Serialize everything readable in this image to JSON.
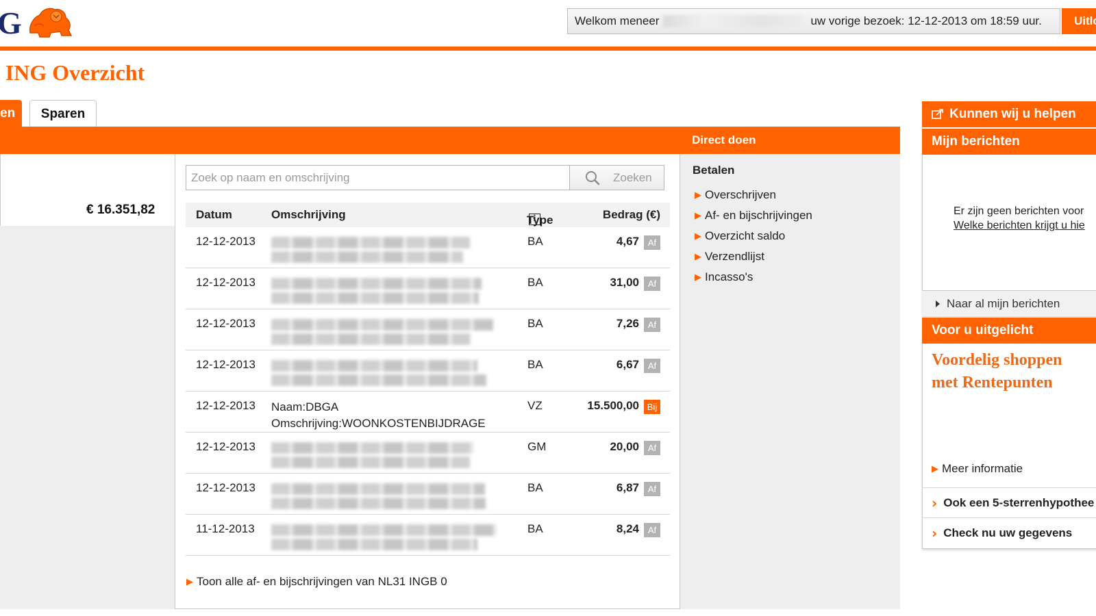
{
  "header": {
    "logo_text": "G",
    "welcome": "Welkom meneer",
    "last_visit": "uw vorige bezoek: 12-12-2013 om 18:59 uur.",
    "logout_label": "Uitlo"
  },
  "page": {
    "title": "n ING Overzicht"
  },
  "tabs": [
    {
      "label": "en",
      "active": true
    },
    {
      "label": "Sparen",
      "active": false
    }
  ],
  "account": {
    "balance": "€ 16.351,82"
  },
  "search": {
    "placeholder": "Zoek op naam en omschrijving",
    "button_label": "Zoeken"
  },
  "table": {
    "headers": {
      "date": "Datum",
      "description": "Omschrijving",
      "type": "Type",
      "amount": "Bedrag (€)"
    },
    "rows": [
      {
        "date": "12-12-2013",
        "desc1": "",
        "desc2": "",
        "blurred": true,
        "type": "BA",
        "amount": "4,67",
        "badge": "Af"
      },
      {
        "date": "12-12-2013",
        "desc1": "",
        "desc2": "",
        "blurred": true,
        "type": "BA",
        "amount": "31,00",
        "badge": "Af"
      },
      {
        "date": "12-12-2013",
        "desc1": "",
        "desc2": "",
        "blurred": true,
        "type": "BA",
        "amount": "7,26",
        "badge": "Af"
      },
      {
        "date": "12-12-2013",
        "desc1": "",
        "desc2": "",
        "blurred": true,
        "type": "BA",
        "amount": "6,67",
        "badge": "Af"
      },
      {
        "date": "12-12-2013",
        "desc1": "Naam:DBGA",
        "desc2": "Omschrijving:WOONKOSTENBIJDRAGE",
        "blurred": false,
        "type": "VZ",
        "amount": "15.500,00",
        "badge": "Bij"
      },
      {
        "date": "12-12-2013",
        "desc1": "",
        "desc2": "",
        "blurred": true,
        "type": "GM",
        "amount": "20,00",
        "badge": "Af"
      },
      {
        "date": "12-12-2013",
        "desc1": "",
        "desc2": "",
        "blurred": true,
        "type": "BA",
        "amount": "6,87",
        "badge": "Af"
      },
      {
        "date": "11-12-2013",
        "desc1": "",
        "desc2": "",
        "blurred": true,
        "type": "BA",
        "amount": "8,24",
        "badge": "Af"
      }
    ],
    "show_all": "Toon alle af- en bijschrijvingen van NL31 INGB 0"
  },
  "direct": {
    "title": "Direct doen",
    "section": "Betalen",
    "links": [
      "Overschrijven",
      "Af- en bijschrijvingen",
      "Overzicht saldo",
      "Verzendlijst",
      "Incasso's"
    ]
  },
  "sidebar": {
    "help_title": "Kunnen wij u helpen",
    "messages_title": "Mijn berichten",
    "no_messages": "Er zijn geen berichten voor",
    "which_messages": "Welke berichten krijgt u hie",
    "all_messages": "Naar al mijn berichten",
    "featured_title": "Voor u uitgelicht",
    "featured_line1": "Voordelig shoppen",
    "featured_line2": "met Rentepunten",
    "more_info": "Meer informatie",
    "promo_items": [
      "Ook een 5-sterrenhypothee",
      "Check nu uw gegevens"
    ]
  },
  "colors": {
    "brand_orange": "#ff6200",
    "brand_blue": "#1b2a6b",
    "badge_gray": "#b3b3b3"
  }
}
